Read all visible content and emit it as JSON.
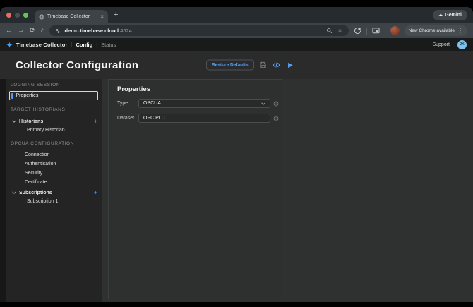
{
  "browser": {
    "tab_title": "Timebase Collector",
    "gemini_label": "Gemini",
    "url_host": "demo.timebase.cloud",
    "url_port": ":4524",
    "update_label": "New Chrome available"
  },
  "glyphs": {
    "close": "×",
    "new_tab": "+",
    "sparkle": "✦",
    "back": "←",
    "forward": "→",
    "reload": "⟳",
    "home": "⌂",
    "star": "☆",
    "menu": "⋮",
    "plus": "+"
  },
  "app_header": {
    "brand": "Timebase Collector",
    "divider": "|",
    "nav_config": "Config",
    "nav_status": "Status",
    "support": "Support",
    "avatar_initials": "JK"
  },
  "page": {
    "title": "Collector Configuration",
    "restore_defaults": "Restore Defaults"
  },
  "sidebar": {
    "section_logging": {
      "label": "LOGGING SESSION",
      "selected_item": "Properties"
    },
    "section_historians": {
      "label": "TARGET HISTORIANS",
      "group": "Historians",
      "child": "Primary Historian",
      "add": "+"
    },
    "section_opcua": {
      "label": "OPCUA CONFIGURATION",
      "items": [
        "Connection",
        "Authentication",
        "Security",
        "Certificate"
      ],
      "group": "Subscriptions",
      "child": "Subscription 1",
      "add": "+"
    }
  },
  "panel": {
    "title": "Properties",
    "type_label": "Type",
    "type_value": "OPCUA",
    "dataset_label": "Dataset",
    "dataset_value": "OPC PLC"
  },
  "colors": {
    "accent_blue": "#4f9cf9",
    "avatar_blue": "#7ec3ec",
    "header_bg": "#191a1a"
  }
}
